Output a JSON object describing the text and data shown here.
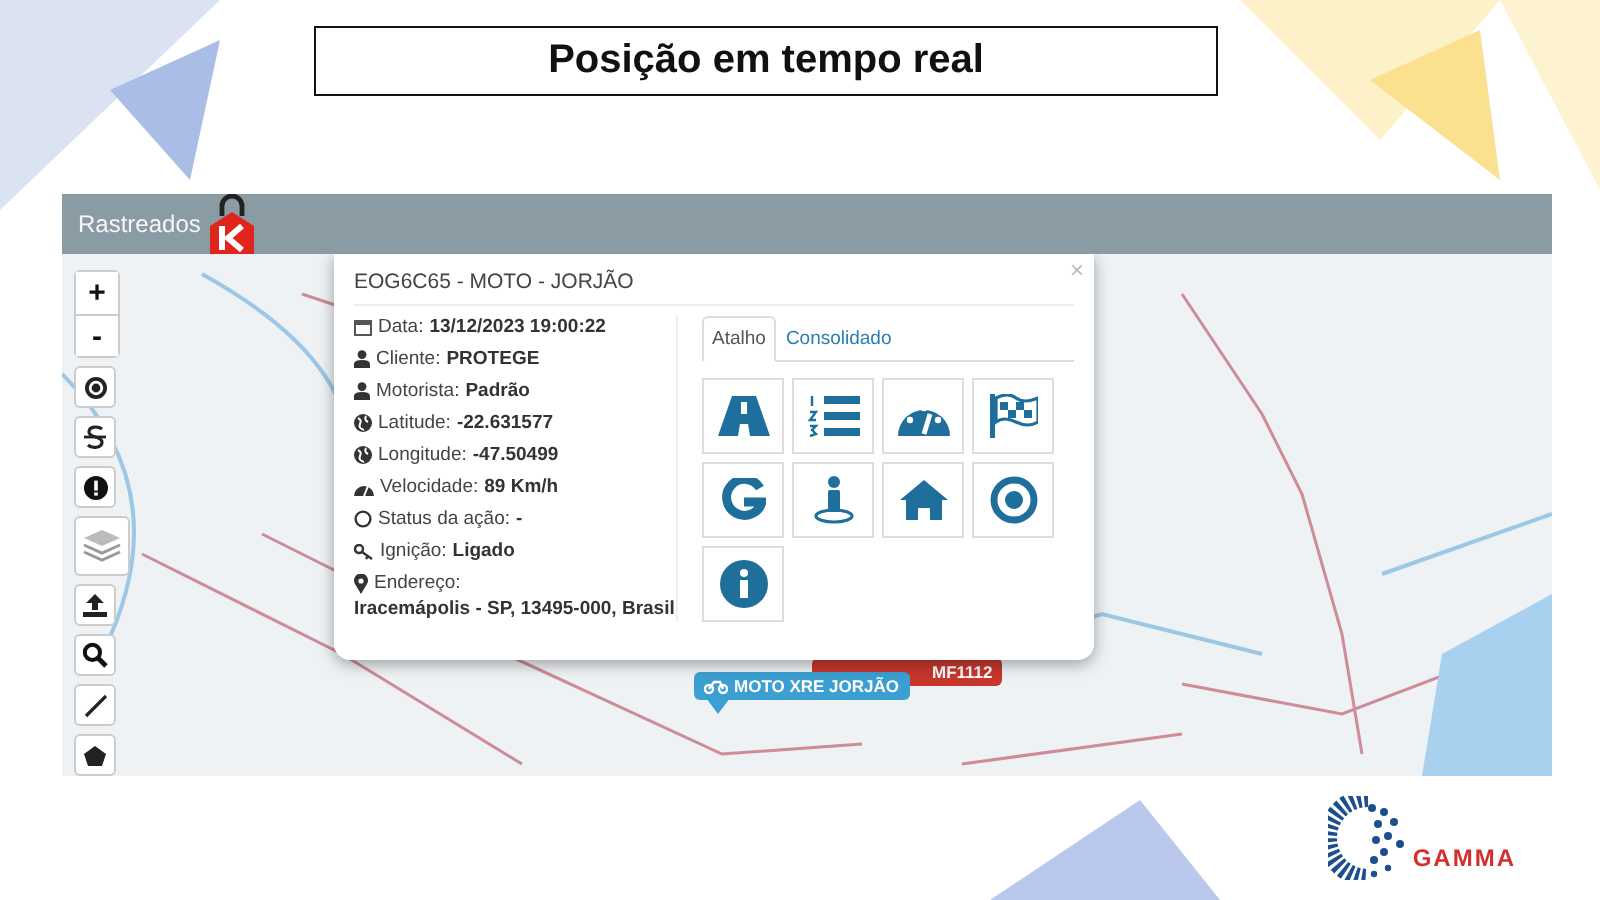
{
  "slide": {
    "title": "Posição em tempo real"
  },
  "panel": {
    "header_title": "Rastreados"
  },
  "map_controls": [
    {
      "kind": "zoom_in",
      "label": "+"
    },
    {
      "kind": "zoom_out",
      "label": "-"
    },
    {
      "kind": "target"
    },
    {
      "kind": "strike"
    },
    {
      "kind": "alert"
    },
    {
      "kind": "layers"
    },
    {
      "kind": "upload"
    },
    {
      "kind": "search"
    },
    {
      "kind": "line"
    },
    {
      "kind": "polygon"
    }
  ],
  "popup": {
    "title": "EOG6C65 - MOTO - JORJÃO",
    "close": "×",
    "fields": [
      {
        "kind": "calendar",
        "label": "Data:",
        "value": "13/12/2023 19:00:22"
      },
      {
        "kind": "user",
        "label": "Cliente:",
        "value": "PROTEGE"
      },
      {
        "kind": "user",
        "label": "Motorista:",
        "value": "Padrão"
      },
      {
        "kind": "globe",
        "label": "Latitude:",
        "value": "-22.631577"
      },
      {
        "kind": "globe",
        "label": "Longitude:",
        "value": "-47.50499"
      },
      {
        "kind": "gauge",
        "label": "Velocidade:",
        "value": "89 Km/h"
      },
      {
        "kind": "status",
        "label": "Status da ação:",
        "value": "-"
      },
      {
        "kind": "key",
        "label": "Ignição:",
        "value": "Ligado"
      }
    ],
    "address": {
      "label": "Endereço:",
      "value": "Iracemápolis - SP, 13495-000, Brasil"
    },
    "tabs": [
      {
        "label": "Atalho",
        "selected": true
      },
      {
        "label": "Consolidado",
        "selected": false
      }
    ],
    "shortcuts": [
      {
        "kind": "road"
      },
      {
        "kind": "list"
      },
      {
        "kind": "gauge"
      },
      {
        "kind": "flag"
      },
      {
        "kind": "google"
      },
      {
        "kind": "person"
      },
      {
        "kind": "home"
      },
      {
        "kind": "target"
      },
      {
        "kind": "info"
      }
    ]
  },
  "markers": [
    {
      "label": "MF1112",
      "color": "#c8372d"
    },
    {
      "label": "MOTO XRE JORJÃO",
      "color": "#3b9fd1"
    }
  ],
  "logo": {
    "text": "GAMMA"
  }
}
